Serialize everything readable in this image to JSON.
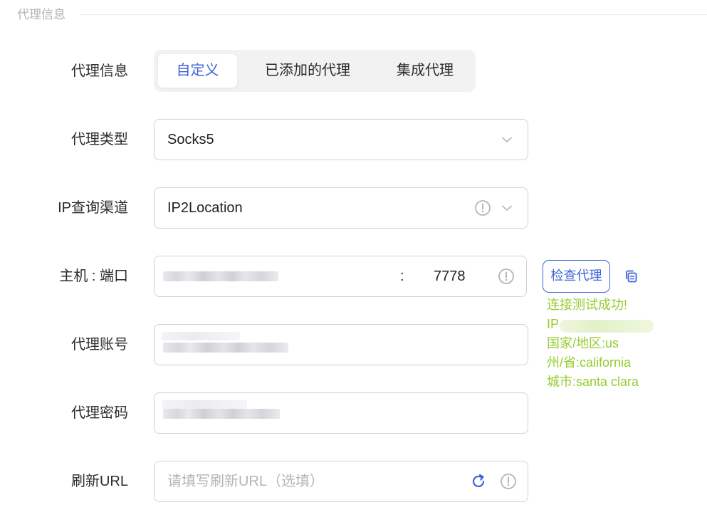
{
  "section": {
    "title": "代理信息"
  },
  "labels": {
    "proxy_info": "代理信息",
    "proxy_type": "代理类型",
    "ip_channel": "IP查询渠道",
    "host_port": "主机 : 端口",
    "account": "代理账号",
    "password": "代理密码",
    "refresh_url": "刷新URL"
  },
  "tabs": [
    {
      "label": "自定义",
      "active": true
    },
    {
      "label": "已添加的代理",
      "active": false
    },
    {
      "label": "集成代理",
      "active": false
    }
  ],
  "proxy_type": {
    "value": "Socks5"
  },
  "ip_channel": {
    "value": "IP2Location"
  },
  "host_port": {
    "separator": ":",
    "port": "7778"
  },
  "refresh_url": {
    "placeholder": "请填写刷新URL（选填）"
  },
  "check_button": {
    "label": "检查代理"
  },
  "result": {
    "status": "连接测试成功!",
    "ip_prefix": "IP",
    "country": "国家/地区:us",
    "state": "州/省:california",
    "city": "城市:santa clara"
  },
  "colors": {
    "accent": "#3d63d9",
    "success": "#94cc2f",
    "border": "#d3d3d6",
    "segment_bg": "#f2f2f3"
  },
  "icons": {
    "chevron": "chevron-down-icon",
    "info": "exclamation-circle-icon",
    "refresh": "refresh-icon",
    "copy": "copy-icon"
  }
}
